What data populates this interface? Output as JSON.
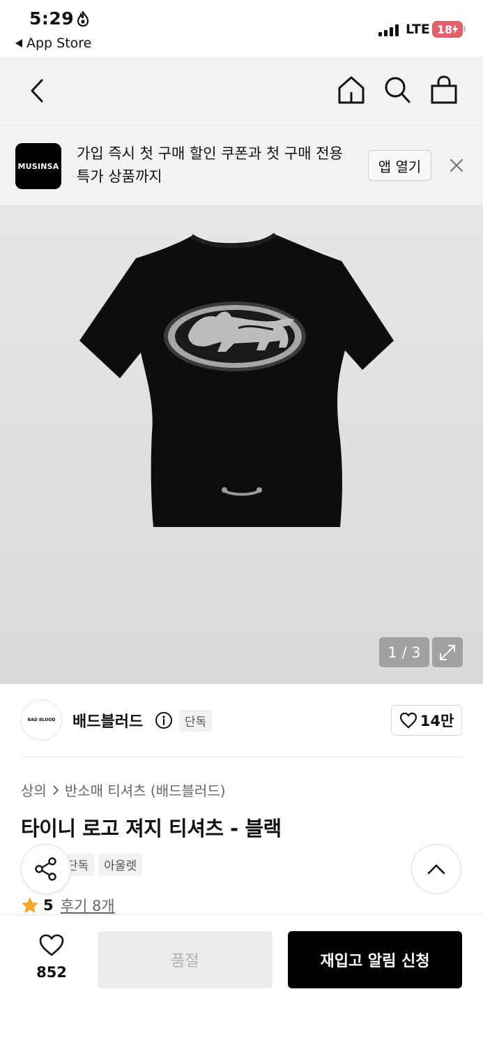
{
  "status_bar": {
    "time": "5:29",
    "back_label": "App Store",
    "network": "LTE",
    "battery": "18"
  },
  "nav": {
    "icons": [
      "back-icon",
      "home-icon",
      "search-icon",
      "shopping-bag-icon"
    ]
  },
  "banner": {
    "logo_text": "MUSINSA",
    "message": "가입 즉시 첫 구매 할인 쿠폰과 첫 구매 전용 특가 상품까지",
    "open_app_label": "앱 열기"
  },
  "gallery": {
    "page_indicator": "1 / 3"
  },
  "brand": {
    "avatar_text": "BAD BLOOD",
    "name": "배드블러드",
    "badge": "단독",
    "likes": "14만"
  },
  "product": {
    "breadcrumb": [
      "상의",
      "반소매 티셔츠 (배드블러드)"
    ],
    "title": "타이니 로고 져지 티셔츠 - 블랙",
    "tags": [
      "단독",
      "아울렛"
    ],
    "rating": "5",
    "reviews": "후기 8개"
  },
  "bottom": {
    "wish_count": "852",
    "soldout_label": "품절",
    "restock_label": "재입고 알림 신청"
  },
  "colors": {
    "accent_black": "#000000",
    "battery_red": "#e0616b",
    "star": "#f5a623",
    "disabled_gray": "#ebebeb"
  }
}
